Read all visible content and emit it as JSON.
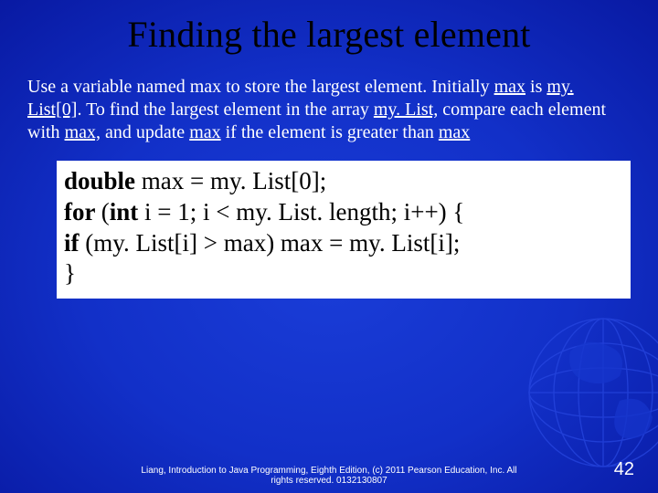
{
  "title": "Finding the largest element",
  "paragraph": {
    "p1": "Use a variable named max to store the largest element. Initially ",
    "p2": "max",
    "p3": " is ",
    "p4": "my. List[0]",
    "p5": ".  To find the largest element in the array ",
    "p6": "my. List,",
    "p7": " compare each element with ",
    "p8": "max,",
    "p9": " and update ",
    "p10": "max",
    "p11": " if the element is greater than ",
    "p12": "max"
  },
  "code": {
    "l1a": "double ",
    "l1b": "max = my. List[0];",
    "l2a": "for ",
    "l2b": "(",
    "l2c": "int ",
    "l2d": "i = 1; i < my. List. length; i++) {",
    "l3a": " if ",
    "l3b": "(my. List[i] > max) max = my. List[i];",
    "l4": "}"
  },
  "footer_line1": "Liang, Introduction to Java Programming, Eighth Edition, (c) 2011 Pearson Education, Inc. All",
  "footer_line2": "rights reserved. 0132130807",
  "page_number": "42"
}
